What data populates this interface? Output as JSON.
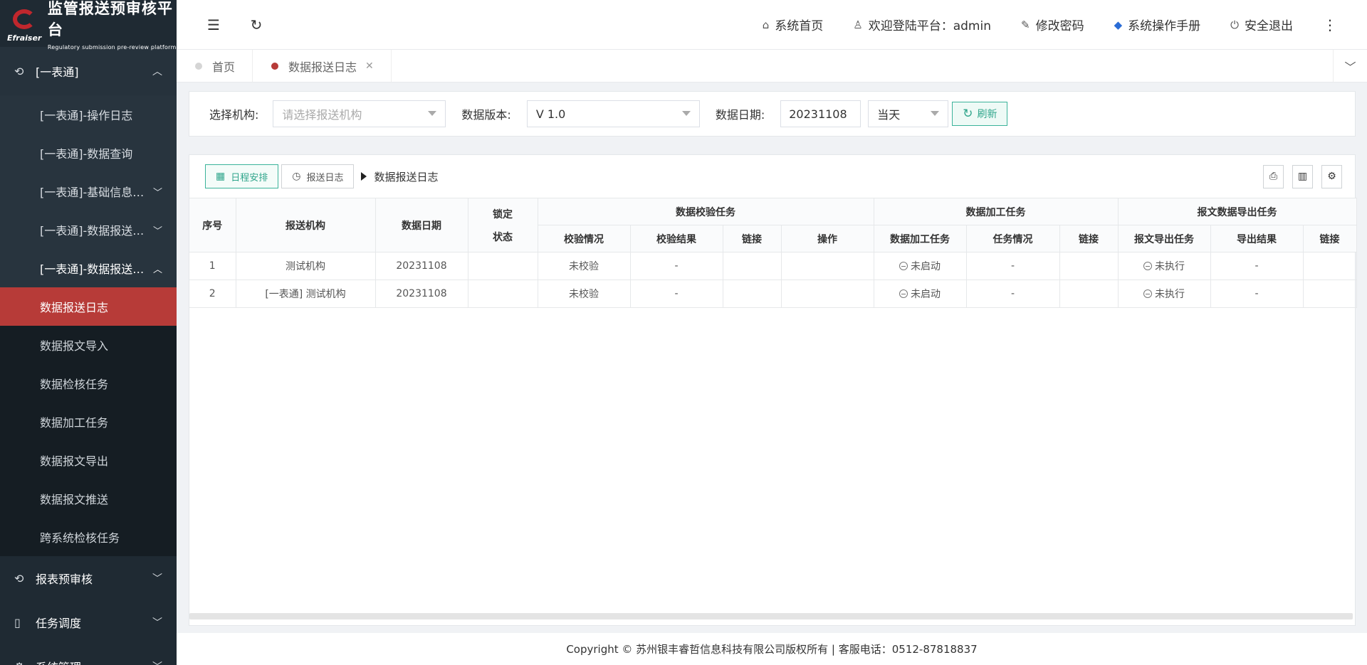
{
  "logo": {
    "title": "监管报送预审核平台",
    "subtitle": "Regulatory submission pre-review platform",
    "brand": "Efraiser"
  },
  "sidebar": {
    "group1": {
      "label": "[一表通]"
    },
    "items": [
      {
        "label": "[一表通]-操作日志"
      },
      {
        "label": "[一表通]-数据查询"
      },
      {
        "label": "[一表通]-基础信息维..."
      },
      {
        "label": "[一表通]-数据报送配..."
      },
      {
        "label": "[一表通]-数据报送任..."
      }
    ],
    "subitems": [
      {
        "label": "数据报送日志"
      },
      {
        "label": "数据报文导入"
      },
      {
        "label": "数据检核任务"
      },
      {
        "label": "数据加工任务"
      },
      {
        "label": "数据报文导出"
      },
      {
        "label": "数据报文推送"
      },
      {
        "label": "跨系统检核任务"
      }
    ],
    "group2": {
      "label": "报表预审核"
    },
    "group3": {
      "label": "任务调度"
    },
    "group4": {
      "label": "系统管理"
    }
  },
  "header": {
    "home": "系统首页",
    "welcome": "欢迎登陆平台：admin",
    "change_password": "修改密码",
    "manual": "系统操作手册",
    "logout": "安全退出"
  },
  "tabs": [
    {
      "label": "首页"
    },
    {
      "label": "数据报送日志"
    }
  ],
  "filter": {
    "org_label": "选择机构:",
    "org_placeholder": "请选择报送机构",
    "version_label": "数据版本:",
    "version_value": "V 1.0",
    "date_label": "数据日期:",
    "date_value": "20231108",
    "period_value": "当天",
    "refresh_label": "刷新"
  },
  "toolbar": {
    "schedule_label": "日程安排",
    "log_label": "报送日志",
    "breadcrumb": "数据报送日志"
  },
  "table": {
    "headers": {
      "seq": "序号",
      "org": "报送机构",
      "date": "数据日期",
      "lock_1": "锁定",
      "lock_2": "状态",
      "group_check": "数据校验任务",
      "group_process": "数据加工任务",
      "group_export": "报文数据导出任务",
      "check_status": "校验情况",
      "check_result": "校验结果",
      "check_link": "链接",
      "check_op": "操作",
      "process_task": "数据加工任务",
      "process_status": "任务情况",
      "process_link": "链接",
      "export_task": "报文导出任务",
      "export_result": "导出结果",
      "export_link": "链接"
    },
    "rows": [
      {
        "seq": "1",
        "org": "测试机构",
        "date": "20231108",
        "check_status": "未校验",
        "check_result": "-",
        "process_task": "未启动",
        "process_status": "-",
        "export_task": "未执行",
        "export_result": "-"
      },
      {
        "seq": "2",
        "org": "[一表通] 测试机构",
        "date": "20231108",
        "check_status": "未校验",
        "check_result": "-",
        "process_task": "未启动",
        "process_status": "-",
        "export_task": "未执行",
        "export_result": "-"
      }
    ]
  },
  "footer": {
    "text": "Copyright © 苏州银丰睿哲信息科技有限公司版权所有 | 客服电话：0512-87818837"
  }
}
